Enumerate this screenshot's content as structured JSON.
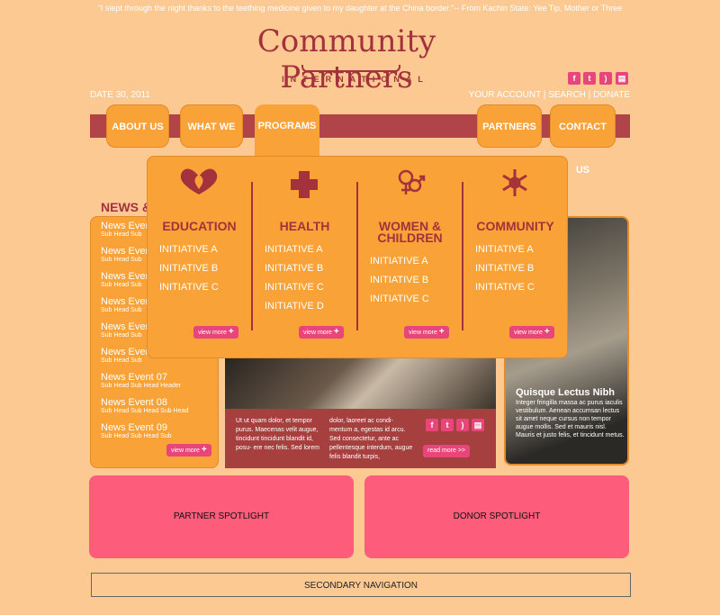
{
  "header": {
    "quote": "\"I slept through the night thanks to the teething medicine given to my daughter at the China border.\"-- From Kachin State: Yee Tip, Mother or Three",
    "logo_main": "Community Partners",
    "logo_sub": "INTERNATIONAL",
    "date": "DATE 30, 2011",
    "links": [
      "YOUR ACCOUNT",
      "SEARCH",
      "DONATE"
    ],
    "social_icons": [
      "facebook-icon",
      "twitter-icon",
      "rss-icon",
      "chat-icon"
    ]
  },
  "nav": {
    "tabs": [
      "ABOUT US",
      "WHAT WE DO",
      "PROGRAMS",
      "PARTNERS",
      "CONTACT US"
    ]
  },
  "mega_menu": {
    "columns": [
      {
        "title": "EDUCATION",
        "title2": "",
        "icon": "heart-leaf-icon",
        "items": [
          "INITIATIVE A",
          "INITIATIVE B",
          "INITIATIVE C"
        ]
      },
      {
        "title": "HEALTH",
        "title2": "",
        "icon": "plus-cross-icon",
        "items": [
          "INITIATIVE A",
          "INITIATIVE B",
          "INITIATIVE C",
          "INITIATIVE D"
        ]
      },
      {
        "title": "WOMEN &",
        "title2": "CHILDREN",
        "icon": "gender-icon",
        "items": [
          "INITIATIVE A",
          "INITIATIVE B",
          "INITIATIVE C"
        ]
      },
      {
        "title": "COMMUNITY",
        "title2": "",
        "icon": "snowflake-icon",
        "items": [
          "INITIATIVE A",
          "INITIATIVE B",
          "INITIATIVE C"
        ]
      }
    ],
    "view_more": "view more"
  },
  "news": {
    "heading": "NEWS &",
    "items": [
      {
        "title": "News Event",
        "sub": "Sub Head Sub"
      },
      {
        "title": "News Event",
        "sub": "Sub Head Sub"
      },
      {
        "title": "News Event",
        "sub": "Sub Head Sub"
      },
      {
        "title": "News Event",
        "sub": "Sub Head Sub"
      },
      {
        "title": "News Event",
        "sub": "Sub Head Sub"
      },
      {
        "title": "News Event",
        "sub": "Sub Head Sub"
      },
      {
        "title": "News Event 07",
        "sub": "Sub Head Sub Head Header"
      },
      {
        "title": "News Event 08",
        "sub": "Sub Head Sub Head Sub Head"
      },
      {
        "title": "News Event 09",
        "sub": "Sub Head Sub Head Sub"
      }
    ],
    "view_more": "view more"
  },
  "feature": {
    "col1": "Ut ut quam dolor, et tempor purus. Maecenas velit augue, tincidunt tincidunt blandit id, posu- ere nec felis. Sed lorem",
    "col2": "dolor, laoreet ac condi- mentum a, egestas id arcu. Sed consectetur, ante ac pellentesque interdum, augue felis blandit turpis,",
    "read_more": "read more >>"
  },
  "side_story": {
    "title": "Quisque Lectus Nibh",
    "body": "Integer fringilla massa ac purus iaculis vestibulum. Aenean accumsan lectus sit amet neque cursus non tempor augue mollis. Sed et mauris nisl. Mauris et justo felis, et tincidunt metus."
  },
  "spotlights": {
    "partner": "PARTNER SPOTLIGHT",
    "donor": "DONOR SPOTLIGHT"
  },
  "secondary_nav": "SECONDARY NAVIGATION",
  "colors": {
    "background": "#fdc993",
    "orange": "#f9a238",
    "maroon": "#a3323c",
    "pink": "#fd5c7b"
  }
}
